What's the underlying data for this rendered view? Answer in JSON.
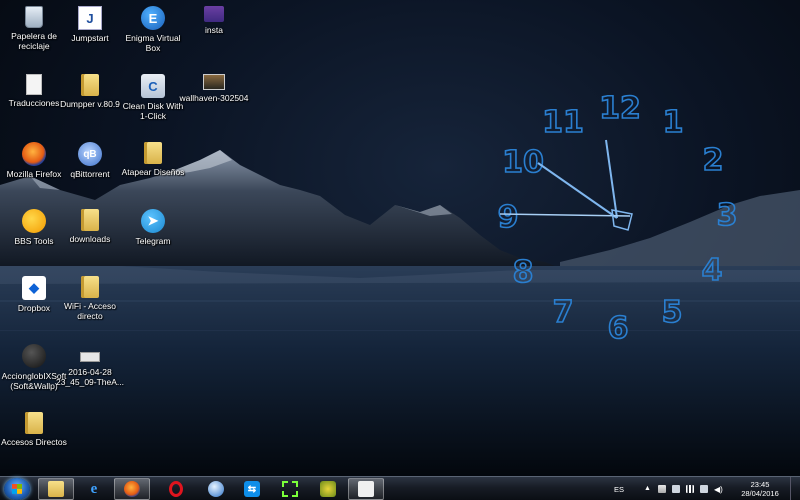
{
  "desktop": {
    "icons": [
      {
        "label": "Papelera de reciclaje",
        "icon": "recycle-bin-icon",
        "glyph": ""
      },
      {
        "label": "Jumpstart",
        "icon": "jumpstart-icon",
        "glyph": "J"
      },
      {
        "label": "Enigma Virtual Box",
        "icon": "enigma-virtual-box-icon",
        "glyph": "E"
      },
      {
        "label": "insta",
        "icon": "image-file-icon",
        "glyph": ""
      },
      {
        "label": "Traducciones",
        "icon": "document-icon",
        "glyph": ""
      },
      {
        "label": "Dumpper v.80.9",
        "icon": "folder-icon",
        "glyph": ""
      },
      {
        "label": "Clean Disk With 1-Click",
        "icon": "clean-disk-icon",
        "glyph": "C"
      },
      {
        "label": "wallhaven-302504",
        "icon": "image-file-icon",
        "glyph": ""
      },
      {
        "label": "Mozilla Firefox",
        "icon": "firefox-icon",
        "glyph": ""
      },
      {
        "label": "qBittorrent",
        "icon": "qbittorrent-icon",
        "glyph": "qB"
      },
      {
        "label": "Atapear Diseños",
        "icon": "folder-icon",
        "glyph": ""
      },
      {
        "label": "BBS Tools",
        "icon": "bbs-tools-icon",
        "glyph": ""
      },
      {
        "label": "downloads",
        "icon": "folder-icon",
        "glyph": ""
      },
      {
        "label": "Telegram",
        "icon": "telegram-icon",
        "glyph": "➤"
      },
      {
        "label": "Dropbox",
        "icon": "dropbox-icon",
        "glyph": "◆"
      },
      {
        "label": "WiFi - Acceso directo",
        "icon": "folder-shortcut-icon",
        "glyph": ""
      },
      {
        "label": "AccionglobIXSoft (Soft&Wallp)",
        "icon": "accionglobix-icon",
        "glyph": ""
      },
      {
        "label": "2016-04-28 23_45_09-TheA...",
        "icon": "keyboard-file-icon",
        "glyph": ""
      },
      {
        "label": "Accesos Directos",
        "icon": "folder-icon",
        "glyph": ""
      }
    ]
  },
  "clock_gadget": {
    "numbers": [
      "12",
      "1",
      "2",
      "3",
      "4",
      "5",
      "6",
      "7",
      "8",
      "9",
      "10",
      "11"
    ],
    "time_shown": "11:45",
    "color": "#2a7fd0"
  },
  "taskbar": {
    "apps": [
      {
        "name": "windows-explorer",
        "icon": "folder-icon",
        "glyph": "",
        "active": true
      },
      {
        "name": "internet-explorer",
        "icon": "internet-explorer-icon",
        "glyph": "e",
        "active": false
      },
      {
        "name": "firefox",
        "icon": "firefox-icon",
        "glyph": "",
        "active": true
      },
      {
        "name": "opera",
        "icon": "opera-icon",
        "glyph": "",
        "active": false
      },
      {
        "name": "browser-globe",
        "icon": "globe-icon",
        "glyph": "",
        "active": false
      },
      {
        "name": "teamviewer",
        "icon": "teamviewer-icon",
        "glyph": "⇆",
        "active": false
      },
      {
        "name": "green-tool",
        "icon": "green-tool-icon",
        "glyph": "",
        "active": false
      },
      {
        "name": "key-tool",
        "icon": "key-tool-icon",
        "glyph": "",
        "active": false
      },
      {
        "name": "notepad",
        "icon": "notepad-icon",
        "glyph": "",
        "active": true
      }
    ],
    "tray": {
      "language": "ES",
      "time": "23:45",
      "date": "28/04/2016"
    }
  }
}
